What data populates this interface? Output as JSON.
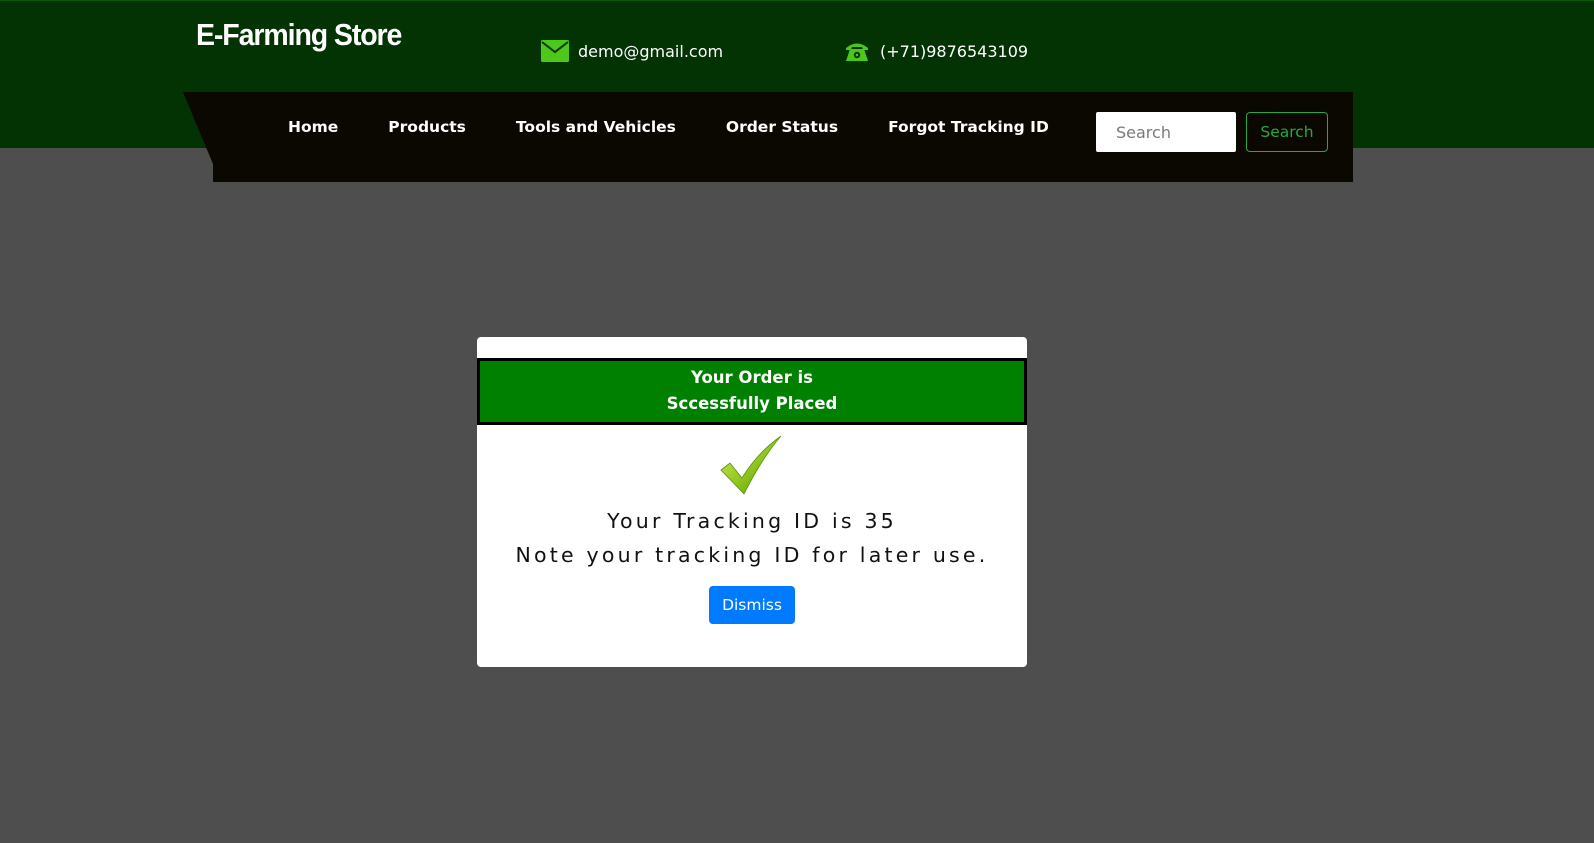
{
  "header": {
    "brand": "E-Farming Store",
    "email": "demo@gmail.com",
    "phone": "(+71)9876543109",
    "email_icon": "envelope-icon",
    "phone_icon": "telephone-icon"
  },
  "nav": {
    "items": [
      {
        "label": "Home"
      },
      {
        "label": "Products"
      },
      {
        "label": "Tools and Vehicles"
      },
      {
        "label": "Order Status"
      },
      {
        "label": "Forgot Tracking ID"
      }
    ],
    "search_placeholder": "Search",
    "search_button": "Search"
  },
  "modal": {
    "title_line1": "Your Order is",
    "title_line2": "Sccessfully Placed",
    "icon": "checkmark-icon",
    "tracking_text": "Your Tracking ID is 35",
    "note_text": "Note your tracking ID for later use.",
    "dismiss_label": "Dismiss"
  },
  "colors": {
    "topbar": "#033203",
    "navbar": "#0a0800",
    "page_background": "#4e4e4e",
    "modal_header": "#008000",
    "icon_green": "#4cc71a",
    "search_button": "#28a745",
    "dismiss_button": "#007bff"
  }
}
